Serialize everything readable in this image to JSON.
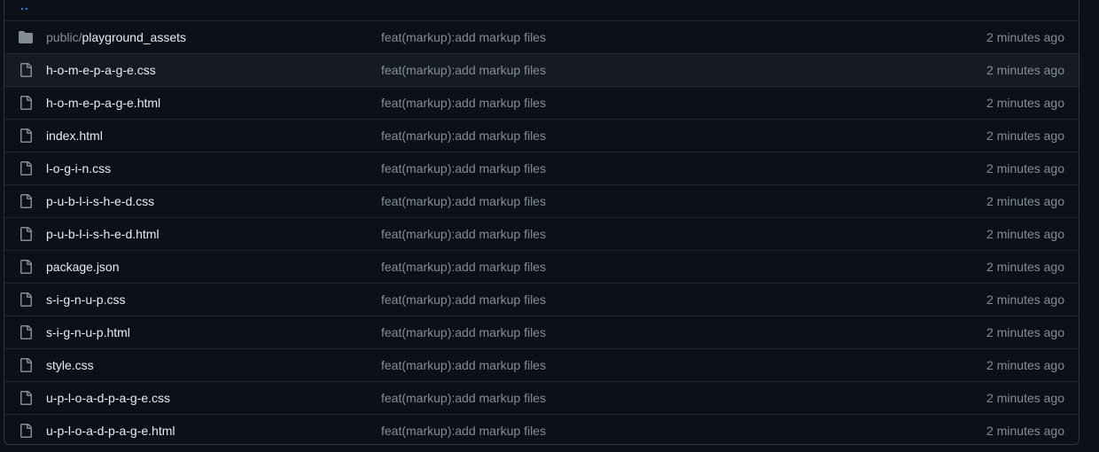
{
  "parent_dir": {
    "label": ".."
  },
  "rows": [
    {
      "type": "folder",
      "icon": "folder-icon",
      "name_prefix": "public/",
      "name": "playground_assets",
      "message": "feat(markup):add markup files",
      "time": "2 minutes ago"
    },
    {
      "type": "file",
      "icon": "file-icon",
      "name_prefix": "",
      "name": "h-o-m-e-p-a-g-e.css",
      "message": "feat(markup):add markup files",
      "time": "2 minutes ago"
    },
    {
      "type": "file",
      "icon": "file-icon",
      "name_prefix": "",
      "name": "h-o-m-e-p-a-g-e.html",
      "message": "feat(markup):add markup files",
      "time": "2 minutes ago"
    },
    {
      "type": "file",
      "icon": "file-icon",
      "name_prefix": "",
      "name": "index.html",
      "message": "feat(markup):add markup files",
      "time": "2 minutes ago"
    },
    {
      "type": "file",
      "icon": "file-icon",
      "name_prefix": "",
      "name": "l-o-g-i-n.css",
      "message": "feat(markup):add markup files",
      "time": "2 minutes ago"
    },
    {
      "type": "file",
      "icon": "file-icon",
      "name_prefix": "",
      "name": "p-u-b-l-i-s-h-e-d.css",
      "message": "feat(markup):add markup files",
      "time": "2 minutes ago"
    },
    {
      "type": "file",
      "icon": "file-icon",
      "name_prefix": "",
      "name": "p-u-b-l-i-s-h-e-d.html",
      "message": "feat(markup):add markup files",
      "time": "2 minutes ago"
    },
    {
      "type": "file",
      "icon": "file-icon",
      "name_prefix": "",
      "name": "package.json",
      "message": "feat(markup):add markup files",
      "time": "2 minutes ago"
    },
    {
      "type": "file",
      "icon": "file-icon",
      "name_prefix": "",
      "name": "s-i-g-n-u-p.css",
      "message": "feat(markup):add markup files",
      "time": "2 minutes ago"
    },
    {
      "type": "file",
      "icon": "file-icon",
      "name_prefix": "",
      "name": "s-i-g-n-u-p.html",
      "message": "feat(markup):add markup files",
      "time": "2 minutes ago"
    },
    {
      "type": "file",
      "icon": "file-icon",
      "name_prefix": "",
      "name": "style.css",
      "message": "feat(markup):add markup files",
      "time": "2 minutes ago"
    },
    {
      "type": "file",
      "icon": "file-icon",
      "name_prefix": "",
      "name": "u-p-l-o-a-d-p-a-g-e.css",
      "message": "feat(markup):add markup files",
      "time": "2 minutes ago"
    },
    {
      "type": "file",
      "icon": "file-icon",
      "name_prefix": "",
      "name": "u-p-l-o-a-d-p-a-g-e.html",
      "message": "feat(markup):add markup files",
      "time": "2 minutes ago"
    }
  ],
  "highlighted_row": 1,
  "colors": {
    "background": "#0d1117",
    "border": "#30363d",
    "text": "#e6edf3",
    "muted": "#848d97",
    "link": "#2f81f7"
  }
}
